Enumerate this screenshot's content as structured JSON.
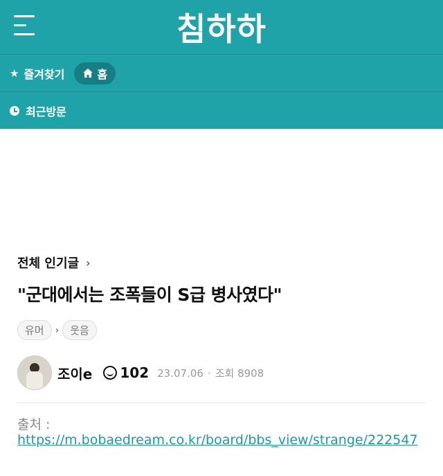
{
  "header": {
    "logo": "침하하",
    "favorites_label": "즐겨찾기",
    "home_label": "홈",
    "recent_label": "최근방문"
  },
  "post": {
    "category": "전체 인기글",
    "title": "\"군대에서는 조폭들이 S급 병사였다\"",
    "tags": [
      "유머",
      "웃음"
    ],
    "author": "조이e",
    "level": "102",
    "date": "23.07.06",
    "views_label": "조회",
    "views": "8908",
    "source_label": "출처 :",
    "source_url": "https://m.bobaedream.co.kr/board/bbs_view/strange/222547"
  },
  "colors": {
    "brand": "#1fa3a8",
    "link": "#1a9aa3"
  },
  "icons": [
    "menu-icon",
    "star-icon",
    "home-icon",
    "clock-icon",
    "chevron-right-icon",
    "smile-icon"
  ]
}
